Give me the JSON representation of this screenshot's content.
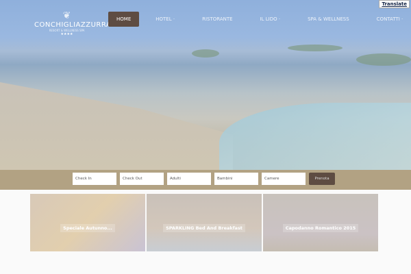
{
  "logo": {
    "name": "CONCHIGLIAZZURRA",
    "subtitle": "RESORT & WELLNESS SPA",
    "stars": "★★★★"
  },
  "translate": "Translate",
  "nav": [
    {
      "label": "HOME",
      "active": true
    },
    {
      "label": "HOTEL  ·"
    },
    {
      "label": "RISTORANTE"
    },
    {
      "label": "IL LIDO  ·"
    },
    {
      "label": "SPA & WELLNESS"
    },
    {
      "label": "CONTATTI  ·"
    }
  ],
  "booking": {
    "fields": [
      "Check In",
      "Check Out",
      "Adulti",
      "Bambini",
      "Camere"
    ],
    "submit": "Prenota"
  },
  "cards": [
    "Speciale Autunno...",
    "SPARKLING Bed And Breakfast",
    "Capodanno Romantico 2015"
  ]
}
